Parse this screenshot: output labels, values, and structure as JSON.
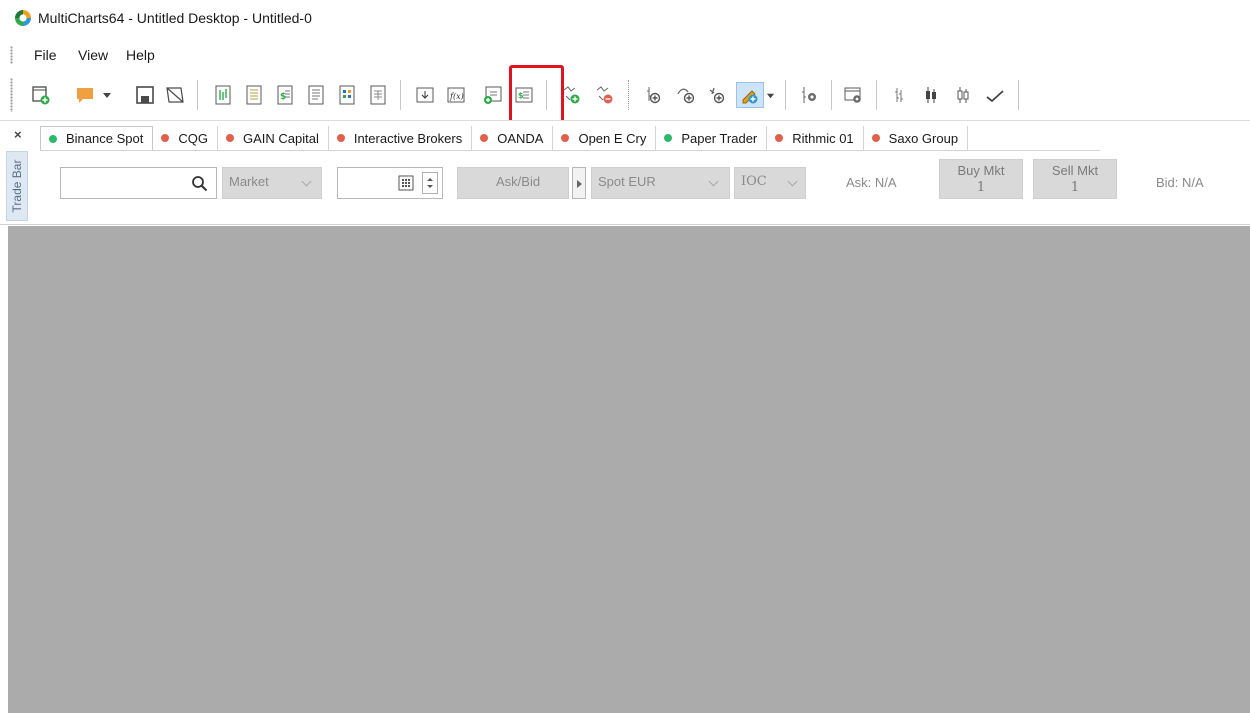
{
  "window": {
    "title": "MultiCharts64 - Untitled Desktop - Untitled-0",
    "logo_icon": "multicharts-logo-icon"
  },
  "menu": {
    "items": [
      "File",
      "View",
      "Help"
    ]
  },
  "toolbar": {
    "icons": [
      "new-window-icon",
      "color-marker-icon",
      "dropdown-arrow-icon",
      "save-icon",
      "close-window-icon",
      "chart-window-icon",
      "scanner-window-icon",
      "dom-window-icon",
      "order-tracker-icon",
      "market-scanner-icon",
      "portfolio-icon",
      "import-data-icon",
      "insert-indicator-icon",
      "insert-study-icon",
      "insert-strategy-icon",
      "add-signal-icon",
      "remove-signal-icon",
      "add-instrument-icon",
      "drawing-tool-icon",
      "insert-object-icon",
      "drawing-pencil-icon",
      "format-instrument-icon",
      "format-window-icon",
      "ohlc-bar-icon",
      "candlestick-icon",
      "hollow-candle-icon",
      "line-chart-icon"
    ],
    "highlighted_icon": "insert-study-icon",
    "highlight_color": "#e0141e"
  },
  "tradebar": {
    "label": "Trade Bar",
    "close_label": "×",
    "tabs": [
      {
        "label": "Binance Spot",
        "status_color": "#2eb86b"
      },
      {
        "label": "CQG",
        "status_color": "#e0604e"
      },
      {
        "label": "GAIN Capital",
        "status_color": "#e0604e"
      },
      {
        "label": "Interactive Brokers",
        "status_color": "#e0604e"
      },
      {
        "label": "OANDA",
        "status_color": "#e0604e"
      },
      {
        "label": "Open E Cry",
        "status_color": "#e0604e"
      },
      {
        "label": "Paper Trader",
        "status_color": "#2eb86b"
      },
      {
        "label": "Rithmic 01",
        "status_color": "#e0604e"
      },
      {
        "label": "Saxo Group",
        "status_color": "#e0604e"
      }
    ],
    "symbol_input": {
      "value": "",
      "placeholder": ""
    },
    "order_type": "Market",
    "quantity": "",
    "ask_bid_label": "Ask/Bid",
    "account": "Spot EUR",
    "tif": "IOC",
    "ask_label": "Ask: N/A",
    "buy_mkt": {
      "label": "Buy Mkt",
      "qty": "1"
    },
    "sell_mkt": {
      "label": "Sell Mkt",
      "qty": "1"
    },
    "bid_label": "Bid: N/A"
  },
  "workspace": {
    "background": "#ababab"
  }
}
